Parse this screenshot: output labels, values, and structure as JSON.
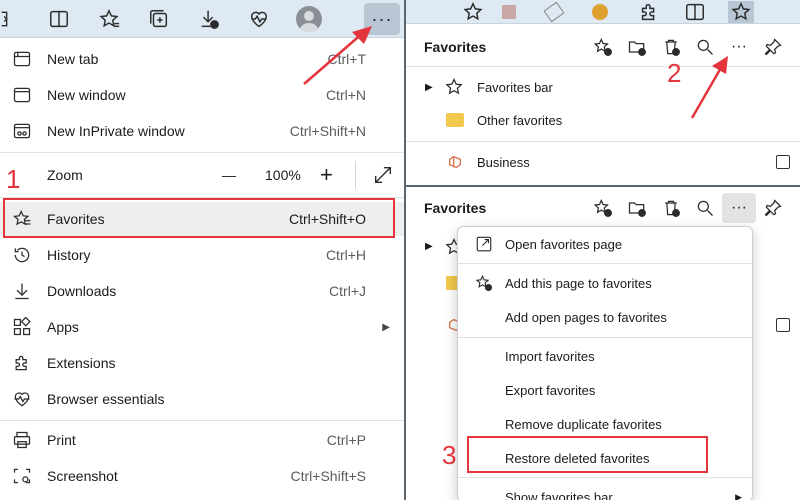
{
  "left_menu": {
    "items": [
      {
        "label": "New tab",
        "shortcut": "Ctrl+T"
      },
      {
        "label": "New window",
        "shortcut": "Ctrl+N"
      },
      {
        "label": "New InPrivate window",
        "shortcut": "Ctrl+Shift+N"
      },
      {
        "label": "Zoom",
        "shortcut": ""
      },
      {
        "label": "Favorites",
        "shortcut": "Ctrl+Shift+O"
      },
      {
        "label": "History",
        "shortcut": "Ctrl+H"
      },
      {
        "label": "Downloads",
        "shortcut": "Ctrl+J"
      },
      {
        "label": "Apps",
        "shortcut": ""
      },
      {
        "label": "Extensions",
        "shortcut": ""
      },
      {
        "label": "Browser essentials",
        "shortcut": ""
      },
      {
        "label": "Print",
        "shortcut": "Ctrl+P"
      },
      {
        "label": "Screenshot",
        "shortcut": "Ctrl+Shift+S"
      }
    ],
    "zoom": {
      "minus": "—",
      "value": "100%",
      "plus": "+"
    },
    "more_label": "···"
  },
  "favorites_panel": {
    "title": "Favorites",
    "rows": [
      {
        "label": "Favorites bar"
      },
      {
        "label": "Other favorites"
      },
      {
        "label": "Business"
      }
    ]
  },
  "favorites_panel_2": {
    "title": "Favorites",
    "more_label": "···"
  },
  "dropdown": {
    "items": [
      {
        "label": "Open favorites page"
      },
      {
        "label": "Add this page to favorites"
      },
      {
        "label": "Add open pages to favorites"
      },
      {
        "label": "Import favorites"
      },
      {
        "label": "Export favorites"
      },
      {
        "label": "Remove duplicate favorites"
      },
      {
        "label": "Restore deleted favorites"
      },
      {
        "label": "Show favorites bar"
      }
    ]
  },
  "annotations": {
    "step1": "1",
    "step2": "2",
    "step3": "3"
  },
  "colors": {
    "accent_red": "#e4343c",
    "toolbar_bg": "#dfe9f3",
    "folder": "#f2c94c",
    "business": "#d9734e"
  }
}
